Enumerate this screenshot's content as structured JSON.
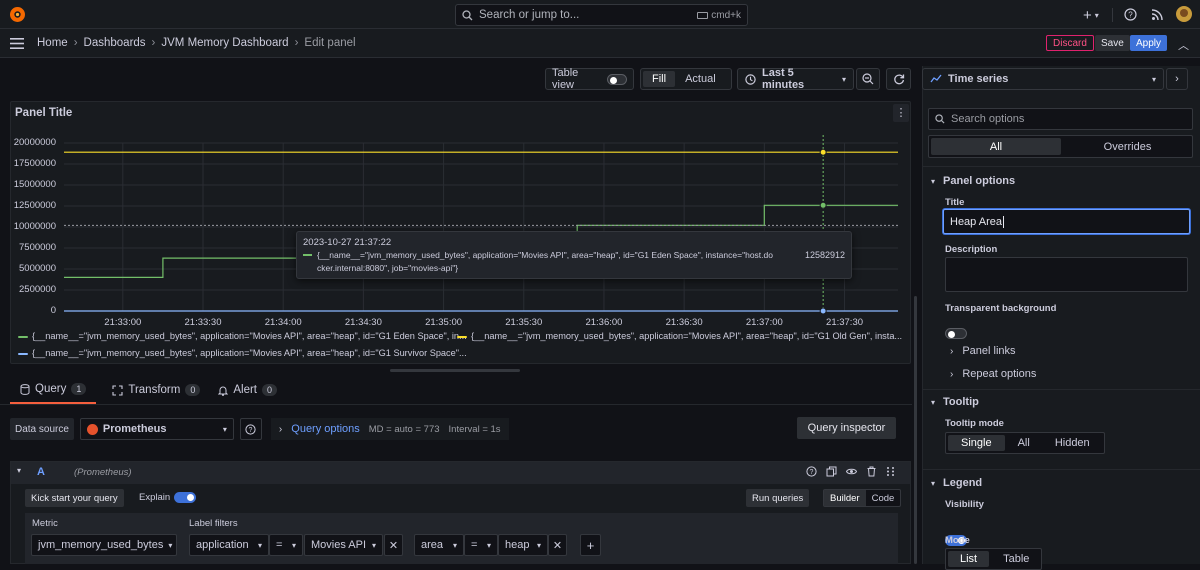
{
  "topbar": {
    "search_placeholder": "Search or jump to...",
    "shortcut": "cmd+k",
    "plus": "+"
  },
  "breadcrumbs": [
    "Home",
    "Dashboards",
    "JVM Memory Dashboard",
    "Edit panel"
  ],
  "actions": {
    "discard": "Discard",
    "save": "Save",
    "apply": "Apply"
  },
  "panel_toolbar": {
    "table_view": "Table view",
    "fill": "Fill",
    "actual": "Actual",
    "time_range": "Last 5 minutes"
  },
  "panel": {
    "title": "Panel Title"
  },
  "chart_data": {
    "type": "line",
    "y_ticks": [
      "20000000",
      "17500000",
      "15000000",
      "12500000",
      "10000000",
      "7500000",
      "5000000",
      "2500000",
      "0"
    ],
    "ylim": [
      0,
      20000000
    ],
    "x_ticks": [
      "21:33:00",
      "21:33:30",
      "21:34:00",
      "21:34:30",
      "21:35:00",
      "21:35:30",
      "21:36:00",
      "21:36:30",
      "21:37:00",
      "21:37:30"
    ],
    "series": [
      {
        "name": "{__name__=\"jvm_memory_used_bytes\", application=\"Movies API\", area=\"heap\", id=\"G1 Eden Space\", in...",
        "color": "#73bf69",
        "points": [
          [
            "21:32:38",
            4000000
          ],
          [
            "21:33:15",
            4000000
          ],
          [
            "21:33:15",
            6300000
          ],
          [
            "21:35:50",
            6300000
          ],
          [
            "21:35:50",
            10200000
          ],
          [
            "21:37:00",
            10200000
          ],
          [
            "21:37:00",
            12582912
          ],
          [
            "21:37:50",
            12582912
          ]
        ]
      },
      {
        "name": "{__name__=\"jvm_memory_used_bytes\", application=\"Movies API\", area=\"heap\", id=\"G1 Old Gen\", insta...",
        "color": "#fade2a",
        "points": [
          [
            "21:32:38",
            18900000
          ],
          [
            "21:37:50",
            18900000
          ]
        ]
      },
      {
        "name": "{__name__=\"jvm_memory_used_bytes\", application=\"Movies API\", area=\"heap\", id=\"G1 Survivor Space\"...",
        "color": "#8ab8ff",
        "points": [
          [
            "21:32:38",
            0
          ],
          [
            "21:37:50",
            0
          ]
        ]
      }
    ],
    "legend_position": "bottom",
    "grid": true
  },
  "tooltip": {
    "time": "2023-10-27 21:37:22",
    "line1": "{__name__=\"jvm_memory_used_bytes\", application=\"Movies API\", area=\"heap\", id=\"G1 Eden Space\", instance=\"host.do",
    "line2": "cker.internal:8080\", job=\"movies-api\"}",
    "value": "12582912"
  },
  "query_tabs": [
    {
      "label": "Query",
      "count": "1"
    },
    {
      "label": "Transform",
      "count": "0"
    },
    {
      "label": "Alert",
      "count": "0"
    }
  ],
  "query_row": {
    "data_source_label": "Data source",
    "data_source": "Prometheus",
    "query_options": "Query options",
    "md": "MD = auto = 773",
    "interval": "Interval = 1s",
    "inspector": "Query inspector"
  },
  "query_a": {
    "ref": "A",
    "datasource": "(Prometheus)",
    "kickstart": "Kick start your query",
    "explain": "Explain",
    "run": "Run queries",
    "builder": "Builder",
    "code": "Code",
    "metric_label": "Metric",
    "metric": "jvm_memory_used_bytes",
    "filters_label": "Label filters",
    "filters": [
      {
        "key": "application",
        "op": "=",
        "value": "Movies API"
      },
      {
        "key": "area",
        "op": "=",
        "value": "heap"
      }
    ]
  },
  "sidebar": {
    "viz": "Time series",
    "search_placeholder": "Search options",
    "tab_all": "All",
    "tab_overrides": "Overrides",
    "panel_options": "Panel options",
    "title_label": "Title",
    "title_value": "Heap Area",
    "description_label": "Description",
    "transparent_label": "Transparent background",
    "panel_links": "Panel links",
    "repeat_options": "Repeat options",
    "tooltip": "Tooltip",
    "tooltip_mode": "Tooltip mode",
    "tooltip_options": [
      "Single",
      "All",
      "Hidden"
    ],
    "legend": "Legend",
    "visibility": "Visibility",
    "mode": "Mode",
    "mode_options": [
      "List",
      "Table"
    ]
  }
}
